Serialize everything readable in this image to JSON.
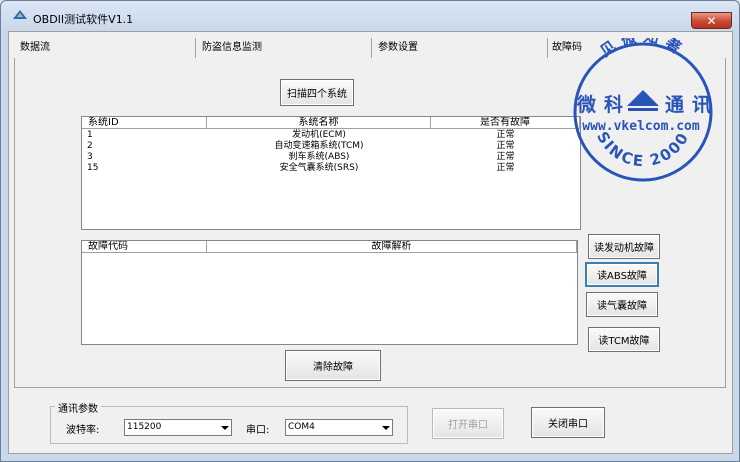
{
  "window": {
    "title": "OBDII测试软件V1.1",
    "close_glyph": "✕"
  },
  "tabs": [
    {
      "label": "数据流"
    },
    {
      "label": "防盗信息监测"
    },
    {
      "label": "参数设置"
    },
    {
      "label": "故障码"
    }
  ],
  "scan_button": "扫描四个系统",
  "system_table": {
    "headers": [
      "系统ID",
      "系统名称",
      "是否有故障"
    ],
    "rows": [
      {
        "id": "1",
        "name": "发动机(ECM)",
        "fault": "正常"
      },
      {
        "id": "2",
        "name": "自动变速箱系统(TCM)",
        "fault": "正常"
      },
      {
        "id": "3",
        "name": "刹车系统(ABS)",
        "fault": "正常"
      },
      {
        "id": "15",
        "name": "安全气囊系统(SRS)",
        "fault": "正常"
      }
    ]
  },
  "fault_table": {
    "headers": [
      "故障代码",
      "故障解析"
    ]
  },
  "side_buttons": {
    "engine": "读发动机故障",
    "abs": "读ABS故障",
    "airbag": "读气囊故障",
    "tcm": "读TCM故障"
  },
  "clear_button": "清除故障",
  "comm": {
    "group_title": "通讯参数",
    "baud_label": "波特率:",
    "baud_value": "115200",
    "port_label": "串口:",
    "port_value": "COM4",
    "open_button": "打开串口",
    "close_button": "关闭串口"
  },
  "watermark": {
    "top_text": "见微知著",
    "left_text": "微科",
    "right_text": "通讯",
    "url": "www.vkelcom.com",
    "since": "SINCE 2000",
    "color": "#2a55b8"
  }
}
